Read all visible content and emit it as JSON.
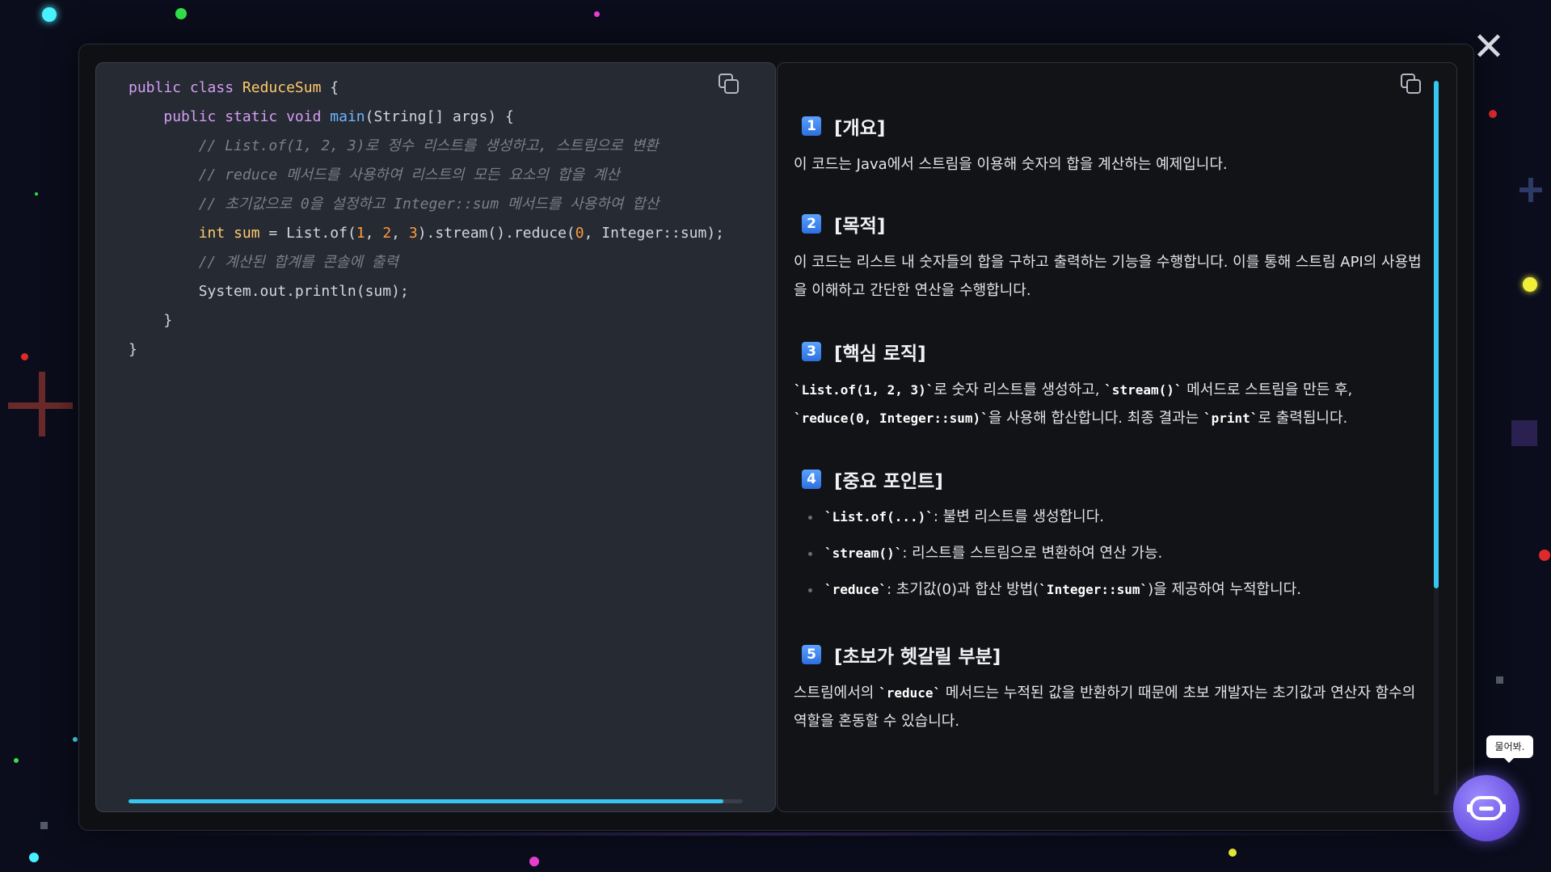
{
  "code": {
    "lines": [
      [
        [
          "kw",
          "public "
        ],
        [
          "kw",
          "class "
        ],
        [
          "ty",
          "ReduceSum"
        ],
        [
          "p",
          " {"
        ]
      ],
      [
        [
          "p",
          "    "
        ],
        [
          "kw",
          "public "
        ],
        [
          "kw",
          "static "
        ],
        [
          "kw",
          "void "
        ],
        [
          "fn",
          "main"
        ],
        [
          "p",
          "(String[] args) {"
        ]
      ],
      [
        [
          "p",
          "        "
        ],
        [
          "cm",
          "// List.of(1, 2, 3)로 정수 리스트를 생성하고, 스트림으로 변환"
        ]
      ],
      [
        [
          "p",
          "        "
        ],
        [
          "cm",
          "// reduce 메서드를 사용하여 리스트의 모든 요소의 합을 계산"
        ]
      ],
      [
        [
          "p",
          "        "
        ],
        [
          "cm",
          "// 초기값으로 0을 설정하고 Integer::sum 메서드를 사용하여 합산"
        ]
      ],
      [
        [
          "p",
          "        "
        ],
        [
          "var",
          "int "
        ],
        [
          "var",
          "sum"
        ],
        [
          "p",
          " = List.of("
        ],
        [
          "num",
          "1"
        ],
        [
          "p",
          ", "
        ],
        [
          "num",
          "2"
        ],
        [
          "p",
          ", "
        ],
        [
          "num",
          "3"
        ],
        [
          "p",
          ").stream().reduce("
        ],
        [
          "num",
          "0"
        ],
        [
          "p",
          ", Integer::sum);"
        ]
      ],
      [
        [
          "p",
          "        "
        ],
        [
          "cm",
          "// 계산된 합계를 콘솔에 출력"
        ]
      ],
      [
        [
          "p",
          "        System.out.println(sum);"
        ]
      ],
      [
        [
          "p",
          "    }"
        ]
      ],
      [
        [
          "p",
          "}"
        ]
      ]
    ]
  },
  "explanation": {
    "sections": [
      {
        "num": "1",
        "title": "[개요]",
        "body": [
          [
            "t",
            "이 코드는 Java에서 스트림을 이용해 숫자의 합을 계산하는 예제입니다."
          ]
        ]
      },
      {
        "num": "2",
        "title": "[목적]",
        "body": [
          [
            "t",
            "이 코드는 리스트 내 숫자들의 합을 구하고 출력하는 기능을 수행합니다. 이를 통해 스트림 API의 사용법을 이해하고 간단한 연산을 수행합니다."
          ]
        ]
      },
      {
        "num": "3",
        "title": "[핵심 로직]",
        "body": [
          [
            "m",
            "`List.of(1, 2, 3)`"
          ],
          [
            "t",
            "로 숫자 리스트를 생성하고, "
          ],
          [
            "m",
            "`stream()`"
          ],
          [
            "t",
            " 메서드로 스트림을 만든 후, "
          ],
          [
            "m",
            "`reduce(0, Integer::sum)`"
          ],
          [
            "t",
            "을 사용해 합산합니다. 최종 결과는 "
          ],
          [
            "m",
            "`print`"
          ],
          [
            "t",
            "로 출력됩니다."
          ]
        ]
      },
      {
        "num": "4",
        "title": "[중요 포인트]",
        "bullets": [
          [
            [
              "m",
              "`List.of(...)`"
            ],
            [
              "t",
              ": 불변 리스트를 생성합니다."
            ]
          ],
          [
            [
              "m",
              "`stream()`"
            ],
            [
              "t",
              ": 리스트를 스트림으로 변환하여 연산 가능."
            ]
          ],
          [
            [
              "m",
              "`reduce`"
            ],
            [
              "t",
              ": 초기값(0)과 합산 방법("
            ],
            [
              "m",
              "`Integer::sum`"
            ],
            [
              "t",
              ")을 제공하여 누적합니다."
            ]
          ]
        ]
      },
      {
        "num": "5",
        "title": "[초보가 헷갈릴 부분]",
        "body": [
          [
            "t",
            "스트림에서의 "
          ],
          [
            "m",
            "`reduce`"
          ],
          [
            "t",
            " 메서드는 누적된 값을 반환하기 때문에 초보 개발자는 초기값과 연산자 함수의 역할을 혼동할 수 있습니다."
          ]
        ]
      }
    ]
  },
  "bot": {
    "tooltip": "물어봐."
  },
  "icons": {
    "close": "close-icon",
    "copy": "copy-icon",
    "bot": "robot-icon"
  },
  "colors": {
    "accent": "#36c6f0",
    "badge": "#3b82f6",
    "bot": "#7a63f0"
  }
}
